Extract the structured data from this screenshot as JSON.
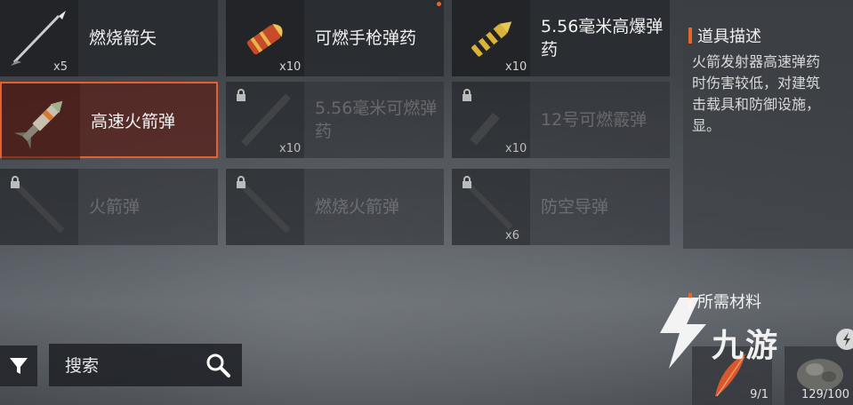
{
  "inventory": {
    "items": [
      {
        "name": "燃烧箭矢",
        "qty": "x5",
        "locked": false,
        "selected": false,
        "icon": "arrow-icon"
      },
      {
        "name": "可燃手枪弹药",
        "qty": "x10",
        "locked": false,
        "selected": false,
        "icon": "pistol-bullet-icon"
      },
      {
        "name": "5.56毫米高爆弹药",
        "qty": "x10",
        "locked": false,
        "selected": false,
        "icon": "rifle-bullet-icon"
      },
      {
        "name": "高速火箭弹",
        "qty": "",
        "locked": false,
        "selected": true,
        "icon": "rocket-icon"
      },
      {
        "name": "5.56毫米可燃弹药",
        "qty": "x10",
        "locked": true,
        "selected": false,
        "icon": "bullet-belt-icon"
      },
      {
        "name": "12号可燃霰弹",
        "qty": "x10",
        "locked": true,
        "selected": false,
        "icon": "shotgun-shell-icon"
      },
      {
        "name": "火箭弹",
        "qty": "",
        "locked": true,
        "selected": false,
        "icon": "rocket-icon"
      },
      {
        "name": "燃烧火箭弹",
        "qty": "",
        "locked": true,
        "selected": false,
        "icon": "rocket-icon"
      },
      {
        "name": "防空导弹",
        "qty": "x6",
        "locked": true,
        "selected": false,
        "icon": "missile-icon"
      }
    ]
  },
  "detail": {
    "desc_title": "道具描述",
    "desc_lines": [
      "火箭发射器高速弹药",
      "时伤害较低，对建筑",
      "击载具和防御设施，",
      "显。"
    ],
    "materials_title": "所需材料",
    "materials": [
      {
        "qty": "9/1",
        "icon": "feather-material-icon"
      },
      {
        "qty": "129/100",
        "icon": "powder-material-icon"
      }
    ]
  },
  "search": {
    "placeholder": "搜索"
  },
  "watermark": {
    "text": "九游"
  },
  "colors": {
    "accent": "#e8662a",
    "selected_bg": "#5a231e",
    "cell_bg": "#26292d"
  }
}
